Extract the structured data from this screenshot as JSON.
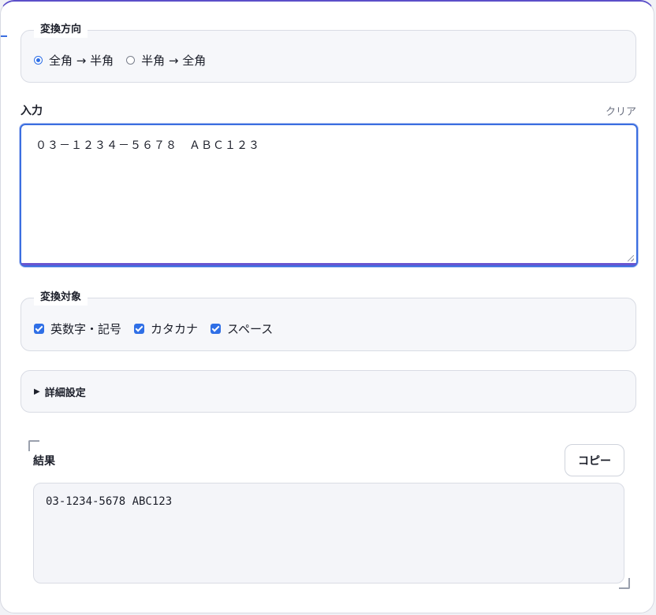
{
  "direction": {
    "legend": "変換方向",
    "options": [
      {
        "label": "全角 → 半角",
        "selected": true
      },
      {
        "label": "半角 → 全角",
        "selected": false
      }
    ]
  },
  "input": {
    "label": "入力",
    "clear_label": "クリア",
    "value": "０３－１２３４－５６７８　ＡＢＣ１２３"
  },
  "targets": {
    "legend": "変換対象",
    "options": [
      {
        "label": "英数字・記号",
        "checked": true
      },
      {
        "label": "カタカナ",
        "checked": true
      },
      {
        "label": "スペース",
        "checked": true
      }
    ]
  },
  "advanced": {
    "label": "詳細設定"
  },
  "result": {
    "label": "結果",
    "copy_label": "コピー",
    "value": "03-1234-5678 ABC123"
  },
  "colors": {
    "accent": "#2f6fe6",
    "focus_ring": "#3b6ee0",
    "card_top": "#5b4fc9"
  },
  "icons": {
    "disclosure": "triangle-right-icon"
  }
}
